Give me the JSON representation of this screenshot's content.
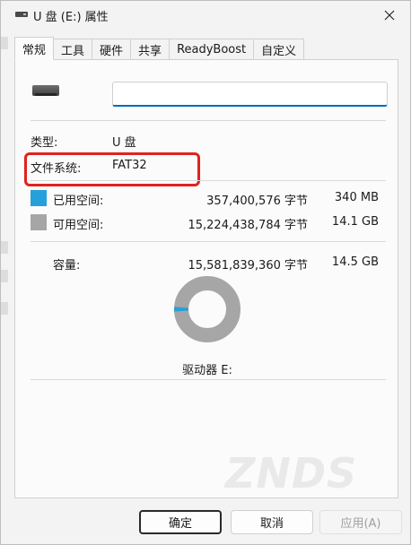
{
  "window": {
    "title": "U 盘 (E:) 属性",
    "close_icon": "close-icon",
    "drive_icon": "usb-drive-icon"
  },
  "tabs": [
    {
      "label": "常规",
      "active": true
    },
    {
      "label": "工具",
      "active": false
    },
    {
      "label": "硬件",
      "active": false
    },
    {
      "label": "共享",
      "active": false
    },
    {
      "label": "ReadyBoost",
      "active": false
    },
    {
      "label": "自定义",
      "active": false
    }
  ],
  "general": {
    "drive_name_value": "",
    "type_label": "类型:",
    "type_value": "U 盘",
    "fs_label": "文件系统:",
    "fs_value": "FAT32",
    "used_label": "已用空间:",
    "used_bytes": "357,400,576 字节",
    "used_size": "340 MB",
    "free_label": "可用空间:",
    "free_bytes": "15,224,438,784 字节",
    "free_size": "14.1 GB",
    "capacity_label": "容量:",
    "capacity_bytes": "15,581,839,360 字节",
    "capacity_size": "14.5 GB",
    "drive_label": "驱动器 E:",
    "used_fraction": 0.0229,
    "used_color": "#26a0da",
    "free_color": "#a6a6a6",
    "highlight_color": "#e0231e"
  },
  "buttons": {
    "ok": "确定",
    "cancel": "取消",
    "apply": "应用(A)"
  },
  "watermark": "ZNDS"
}
